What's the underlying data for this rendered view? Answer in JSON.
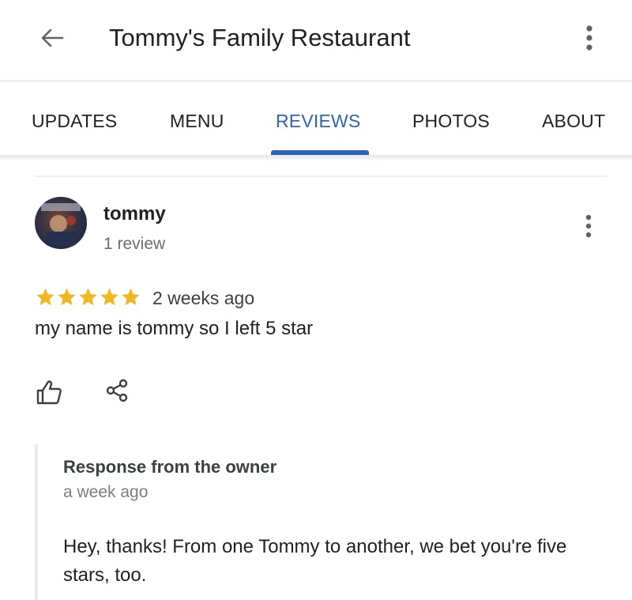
{
  "header": {
    "title": "Tommy's Family Restaurant",
    "back_icon": "arrow-left-icon",
    "menu_icon": "more-vertical-icon"
  },
  "tabs": [
    {
      "label": "UPDATES",
      "active": false
    },
    {
      "label": "MENU",
      "active": false
    },
    {
      "label": "REVIEWS",
      "active": true
    },
    {
      "label": "PHOTOS",
      "active": false
    },
    {
      "label": "ABOUT",
      "active": false
    }
  ],
  "review": {
    "author": "tommy",
    "author_review_count": "1 review",
    "rating": 5,
    "time": "2 weeks ago",
    "text": "my name is tommy so I left 5 star",
    "actions": {
      "like_icon": "thumbs-up-icon",
      "share_icon": "share-icon"
    }
  },
  "owner_response": {
    "title": "Response from the owner",
    "time": "a week ago",
    "text": "Hey, thanks! From one Tommy to another, we bet you're five stars, too."
  },
  "colors": {
    "accent": "#2f63b3",
    "star": "#f2b824",
    "text": "#202124",
    "secondary_text": "#6b6e72"
  }
}
